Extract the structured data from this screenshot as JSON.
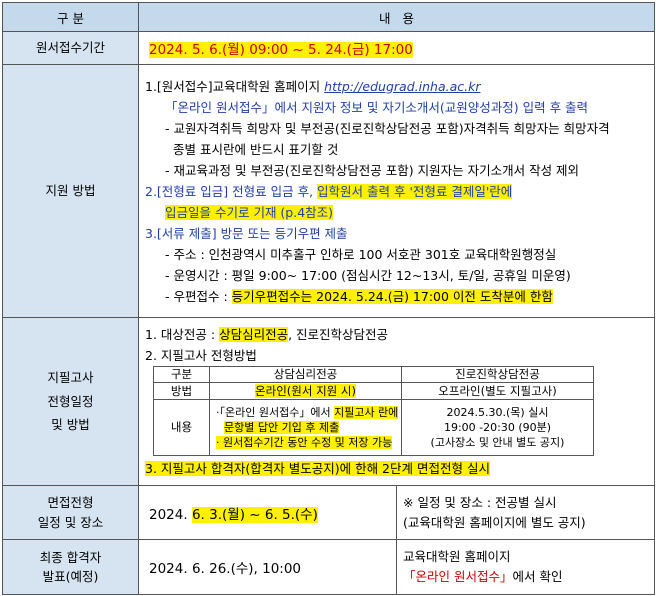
{
  "header": {
    "col1": "구 분",
    "col2": "내   용"
  },
  "period": {
    "label": "원서접수기간",
    "value": "2024. 5. 6.(월) 09:00 ~ 5. 24.(금) 17:00"
  },
  "method": {
    "label": "지원 방법",
    "s1_title": "1.[원서접수]교육대학원 홈페이지 ",
    "s1_url": "http://edugrad.inha.ac.kr",
    "s1_line2": "「온라인 원서접수」에서 지원자 정보 및 자기소개서(교원양성과정) 입력 후 출력",
    "s1_b1a": "- 교원자격취득 희망자 및 부전공(진로진학상담전공 포함)자격취득 희망자는 희망자격",
    "s1_b1b": "종별 표시란에 반드시 표기할 것",
    "s1_b2": "- 재교육과정 및 부전공(진로진학상담전공 포함) 지원자는 자기소개서 작성 제외",
    "s2_line1a": "2.[전형료 입금] 전형료 입금 후, ",
    "s2_line1b": "입학원서 출력 후 '전형료 결제일'란에",
    "s2_line2": "입금일을 수기로 기재 (p.4참조)",
    "s3_title": "3.[서류 제출] 방문 또는 등기우편 제출",
    "s3_b1": "- 주소 : 인천광역시 미추홀구 인하로 100 서호관 301호 교육대학원행정실",
    "s3_b2": "- 운영시간 : 평일 9:00~ 17:00 (점심시간 12~13시, 토/일, 공휴일 미운영)",
    "s3_b3a": "- 우편접수 : ",
    "s3_b3b": "등기우편접수는 2024. 5.24.(금) 17:00 이전 도착분에 한함"
  },
  "exam": {
    "label1": "지필고사",
    "label2": "전형일정",
    "label3": "및 방법",
    "l1a": "1. 대상전공 : ",
    "l1b": "상담심리전공",
    "l1c": ", 진로진학상담전공",
    "l2": "2. 지필고사 전형방법",
    "tbl_h0": "구분",
    "tbl_h1": "상담심리전공",
    "tbl_h2": "진로진학상담전공",
    "tbl_r1_0": "방법",
    "tbl_r1_1": "온라인(원서 지원 시)",
    "tbl_r1_2": "오프라인(별도 지필고사)",
    "tbl_r2_0": "내용",
    "tbl_r2_1a": "·「온라인 원서접수」에서 ",
    "tbl_r2_1b": "지필고사 란에",
    "tbl_r2_1c": "문항별 답안 기입 후 제출",
    "tbl_r2_1d": "· 원서접수기간 동안 수정 및 저장 가능",
    "tbl_r2_2a": "2024.5.30.(목) 실시",
    "tbl_r2_2b": "19:00 -20:30 (90분)",
    "tbl_r2_2c": "(고사장소 및 안내 별도 공지)",
    "l3": "3. 지필고사 합격자(합격자 별도공지)에 한해 2단계 면접전형 실시"
  },
  "interview": {
    "label1": "면접전형",
    "label2": "일정 및 장소",
    "date_a": "2024. ",
    "date_b": "6. 3.(월) ~ 6. 5.(수)",
    "note1": "※ 일정 및 장소 : 전공별 실시",
    "note2": "(교육대학원 홈페이지에 별도 공지)"
  },
  "final": {
    "label1": "최종 합격자",
    "label2": "발표(예정)",
    "date": "2024. 6. 26.(수), 10:00",
    "note1": "교육대학원 홈페이지",
    "note2a": "「온라인 원서접수」",
    "note2b": "에서 확인"
  },
  "colors": {
    "label_bg": "#d6e4f1",
    "header_bg": "#c5d9ec",
    "highlight": "#fff000",
    "link_blue": "#1f3fa8"
  }
}
